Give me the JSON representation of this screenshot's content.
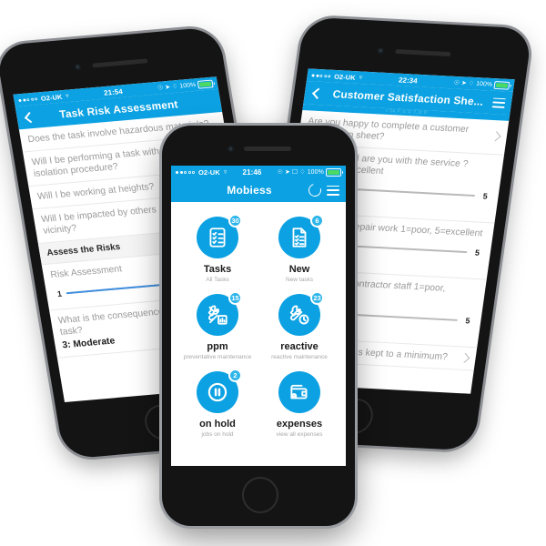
{
  "theme": {
    "brand_blue": "#0ba1e2",
    "badge_blue": "#2eb6ea",
    "slider_blue": "#3f8fe0",
    "page_bg": "#ffffff"
  },
  "front_phone": {
    "status_bar": {
      "carrier": "O2-UK",
      "time": "21:46",
      "battery": "100%"
    },
    "navbar": {
      "title": "Mobiess",
      "refresh_icon": "refresh-icon",
      "menu_icon": "hamburger-menu-icon"
    },
    "tiles": [
      {
        "title": "Tasks",
        "subtitle": "All Tasks",
        "badge": "30",
        "icon": "checklist-clipboard-icon"
      },
      {
        "title": "New",
        "subtitle": "New tasks",
        "badge": "6",
        "icon": "new-document-checklist-icon"
      },
      {
        "title": "ppm",
        "subtitle": "preventative maintenance",
        "badge": "15",
        "icon": "wrench-screwdriver-chart-icon"
      },
      {
        "title": "reactive",
        "subtitle": "reactive maintenance",
        "badge": "23",
        "icon": "wrench-screwdriver-clock-icon"
      },
      {
        "title": "on hold",
        "subtitle": "jobs on hold",
        "badge": "2",
        "icon": "pause-circle-icon"
      },
      {
        "title": "expenses",
        "subtitle": "view all expenses",
        "badge": "",
        "icon": "wallet-icon"
      }
    ]
  },
  "left_phone": {
    "status_bar": {
      "carrier": "O2-UK",
      "time": "21:54",
      "battery": "100%"
    },
    "navbar": {
      "title": "Task Risk Assessment",
      "back_icon": "chevron-left-icon"
    },
    "rows": [
      {
        "kind": "question",
        "text": "Does the task involve hazardous materials?"
      },
      {
        "kind": "question",
        "text": "Will I be performing a task without a specific isolation procedure?"
      },
      {
        "kind": "question",
        "text": "Will I be working at heights?"
      },
      {
        "kind": "question",
        "text": "Will I be impacted by others activity in the vicinity?"
      },
      {
        "kind": "section",
        "text": "Assess the Risks"
      },
      {
        "kind": "slider",
        "text": "Risk Assessment",
        "min": "1",
        "value": "",
        "fill_pct": 74
      },
      {
        "kind": "answer",
        "text": "What is the consequence associated with this task?",
        "answer": "3: Moderate"
      }
    ]
  },
  "right_phone": {
    "status_bar": {
      "carrier": "O2-UK",
      "time": "22:34",
      "battery": "100%"
    },
    "navbar": {
      "title": "Customer Satisfaction She...",
      "back_icon": "chevron-left-icon",
      "menu_icon": "hamburger-menu-icon"
    },
    "navbar_subtitle": "r: 14, F: 0, U: 7, D: 0",
    "rows": [
      {
        "kind": "chevron",
        "text": "Are you happy to complete a customer satisfaction sheet?"
      },
      {
        "kind": "slider",
        "text": "How satisfied are you with the service ? 1=poor, 5=excellent",
        "max": "5",
        "value": "2",
        "fill_pct": 2
      },
      {
        "kind": "slider",
        "text": "Quality of the repair work 1=poor, 5=excellent",
        "max": "5",
        "value": "3",
        "fill_pct": 12
      },
      {
        "kind": "slider",
        "text": "Conduct of the contractor staff 1=poor, 5=excellent",
        "max": "5",
        "value": "3",
        "fill_pct": 26
      },
      {
        "kind": "chevron",
        "text": "Was noise and mess kept to a minimum?"
      }
    ]
  }
}
